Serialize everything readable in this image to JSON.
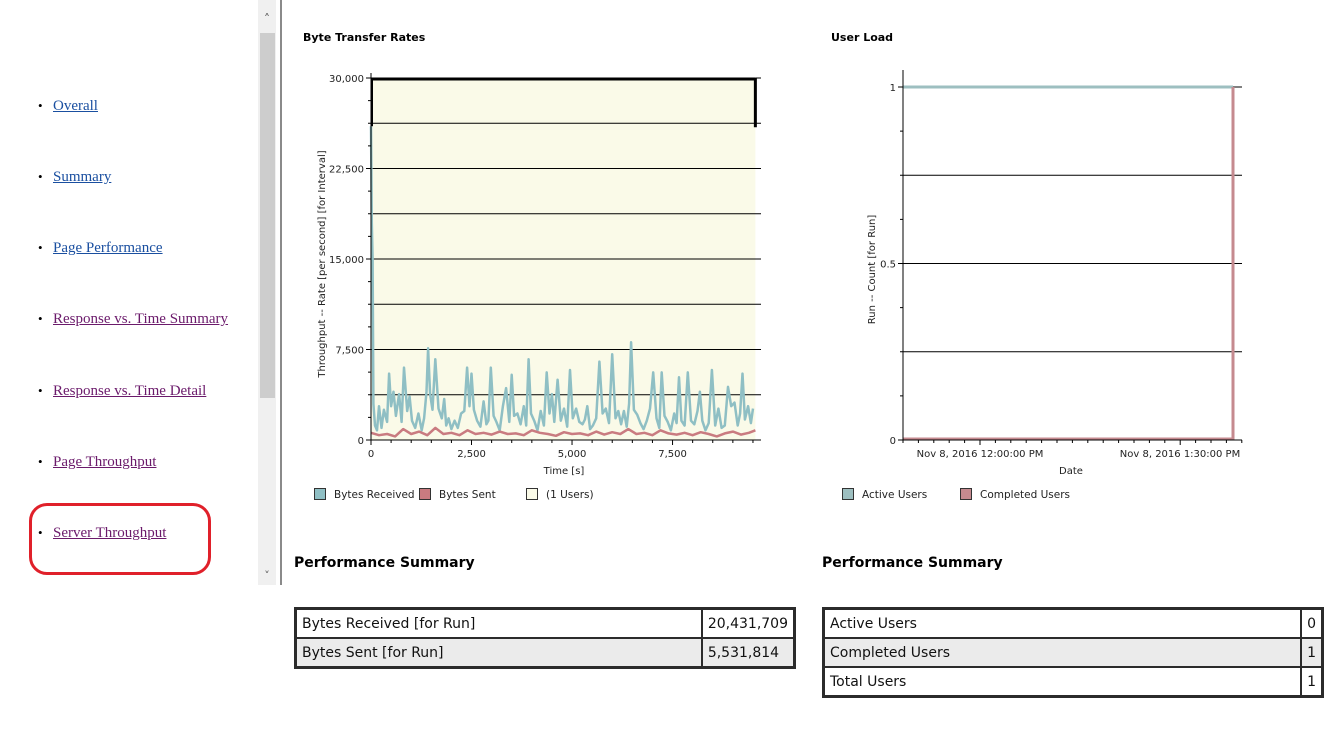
{
  "nav": {
    "items": [
      {
        "label": "Overall",
        "state": "link"
      },
      {
        "label": "Summary",
        "state": "link"
      },
      {
        "label": "Page Performance",
        "state": "link"
      },
      {
        "label": "Response vs. Time Summary",
        "state": "visited"
      },
      {
        "label": "Response vs. Time Detail",
        "state": "visited"
      },
      {
        "label": "Page Throughput",
        "state": "visited"
      },
      {
        "label": "Server Throughput",
        "state": "visited",
        "highlighted": true
      }
    ],
    "bullet": "•",
    "scroll_up_icon": "˄",
    "scroll_down_icon": "˅"
  },
  "colors": {
    "link": "#1a4fa0",
    "visited": "#6b1a6b",
    "highlight": "#e0202a",
    "bytes_received": "#8fbfc4",
    "bytes_sent": "#c97b80",
    "plot_bg": "#fafae8",
    "active_users": "#9dbfc0",
    "completed_users": "#c58a8f"
  },
  "chart_data": [
    {
      "type": "line",
      "title": "Byte Transfer Rates",
      "xlabel": "Time [s]",
      "ylabel": "Throughput -- Rate [per second] [for Interval]",
      "xlim": [
        0,
        9700
      ],
      "ylim": [
        0,
        30000
      ],
      "xticks": [
        0,
        2500,
        5000,
        7500
      ],
      "xtick_labels": [
        "0",
        "2,500",
        "5,000",
        "7,500"
      ],
      "yticks": [
        0,
        7500,
        15000,
        22500,
        30000
      ],
      "ytick_labels": [
        "0",
        "7,500",
        "15,000",
        "22,500",
        "30,000"
      ],
      "gridlines": [
        3750,
        7500,
        11250,
        15000,
        18750,
        22500,
        26250
      ],
      "grid": true,
      "legend": "bottom",
      "series": [
        {
          "name": "Bytes Received",
          "x": [
            0,
            20,
            40,
            60,
            100,
            150,
            200,
            260,
            320,
            400,
            450,
            500,
            560,
            620,
            700,
            760,
            820,
            900,
            960,
            1020,
            1100,
            1180,
            1260,
            1320,
            1380,
            1420,
            1470,
            1530,
            1600,
            1680,
            1760,
            1820,
            1870,
            1930,
            2000,
            2080,
            2160,
            2240,
            2320,
            2390,
            2450,
            2500,
            2560,
            2640,
            2720,
            2800,
            2870,
            2920,
            2980,
            3050,
            3120,
            3200,
            3280,
            3360,
            3440,
            3500,
            3560,
            3640,
            3720,
            3800,
            3860,
            3920,
            3980,
            4060,
            4140,
            4220,
            4300,
            4370,
            4440,
            4500,
            4560,
            4640,
            4720,
            4800,
            4880,
            4950,
            5020,
            5100,
            5180,
            5260,
            5320,
            5380,
            5450,
            5520,
            5600,
            5680,
            5760,
            5840,
            5920,
            6000,
            6080,
            6150,
            6220,
            6290,
            6360,
            6420,
            6470,
            6540,
            6620,
            6700,
            6780,
            6860,
            6940,
            7020,
            7100,
            7170,
            7230,
            7300,
            7380,
            7460,
            7540,
            7600,
            7660,
            7720,
            7800,
            7880,
            7960,
            8040,
            8120,
            8180,
            8240,
            8320,
            8400,
            8480,
            8560,
            8640,
            8720,
            8800,
            8880,
            8960,
            9040,
            9120,
            9180,
            9240,
            9300,
            9380,
            9450,
            9500,
            9560
          ],
          "values": [
            26000,
            18000,
            15000,
            3000,
            1200,
            800,
            2800,
            1000,
            2500,
            1500,
            5500,
            2800,
            4000,
            2000,
            3800,
            1500,
            6000,
            2400,
            3600,
            1600,
            1000,
            2200,
            800,
            1800,
            4000,
            7600,
            3800,
            2500,
            6700,
            2600,
            1800,
            3400,
            1200,
            1800,
            900,
            1600,
            1000,
            2200,
            2400,
            6000,
            2800,
            5500,
            2500,
            1600,
            1100,
            3200,
            1300,
            1600,
            6000,
            2000,
            1500,
            800,
            2800,
            4300,
            1500,
            5400,
            2000,
            2200,
            1300,
            2800,
            1200,
            6700,
            2200,
            1600,
            800,
            2400,
            1200,
            5600,
            2200,
            3800,
            1500,
            5000,
            1600,
            2600,
            1100,
            5800,
            1800,
            2600,
            1500,
            1300,
            1700,
            2800,
            900,
            1200,
            1800,
            6500,
            2200,
            2600,
            1400,
            7100,
            1800,
            2400,
            1300,
            2400,
            1100,
            3000,
            8100,
            2500,
            2100,
            1400,
            900,
            1600,
            2600,
            5600,
            1800,
            1000,
            5600,
            2000,
            1500,
            800,
            2200,
            1400,
            5200,
            1600,
            1200,
            5600,
            1600,
            1300,
            2400,
            4000,
            1600,
            800,
            1400,
            5800,
            1200,
            2600,
            1000,
            1200,
            4400,
            2800,
            3100,
            1200,
            2200,
            5500,
            1700,
            2800,
            1400,
            2600
          ]
        },
        {
          "name": "Bytes Sent",
          "x": [
            0,
            200,
            400,
            600,
            800,
            1000,
            1200,
            1400,
            1600,
            1800,
            2000,
            2200,
            2400,
            2600,
            2800,
            3000,
            3200,
            3400,
            3600,
            3800,
            4000,
            4200,
            4400,
            4600,
            4800,
            5000,
            5200,
            5400,
            5600,
            5800,
            6000,
            6200,
            6400,
            6600,
            6800,
            7000,
            7200,
            7400,
            7600,
            7800,
            8000,
            8200,
            8400,
            8600,
            8800,
            9000,
            9200,
            9400,
            9560
          ],
          "values": [
            600,
            400,
            500,
            300,
            900,
            500,
            700,
            400,
            1000,
            500,
            600,
            400,
            800,
            500,
            600,
            450,
            700,
            500,
            550,
            400,
            800,
            600,
            500,
            350,
            650,
            500,
            550,
            400,
            700,
            450,
            650,
            500,
            900,
            500,
            600,
            400,
            800,
            550,
            450,
            600,
            400,
            650,
            500,
            300,
            550,
            700,
            450,
            600,
            800
          ]
        },
        {
          "name": "(1 Users)",
          "kind": "band",
          "x_range": [
            0,
            9560
          ],
          "value": 30000
        }
      ]
    },
    {
      "type": "line",
      "title": "User Load",
      "xlabel": "Date",
      "ylabel": "Run -- Count [for Run]",
      "ylim": [
        0,
        1.05
      ],
      "yticks": [
        0,
        0.5,
        1
      ],
      "ytick_labels": [
        "0",
        "0.5",
        "1"
      ],
      "gridlines": [
        0.25,
        0.5,
        0.75
      ],
      "xtick_labels": [
        "Nov 8, 2016 12:00:00 PM",
        "Nov 8, 2016 1:30:00 PM"
      ],
      "grid": true,
      "legend": "bottom",
      "series": [
        {
          "name": "Active Users",
          "x": [
            "start",
            "end"
          ],
          "values": [
            1,
            1
          ]
        },
        {
          "name": "Completed Users",
          "x": [
            "start",
            "end",
            "end"
          ],
          "values": [
            0,
            0,
            1
          ]
        }
      ]
    }
  ],
  "charts": {
    "bytes": {
      "title": "Byte Transfer Rates",
      "ylabel": "Throughput -- Rate [per second] [for Interval]",
      "xlabel": "Time [s]",
      "legend": [
        "Bytes Received",
        "Bytes Sent",
        "(1 Users)"
      ]
    },
    "users": {
      "title": "User Load",
      "ylabel": "Run -- Count [for Run]",
      "xlabel": "Date",
      "legend": [
        "Active Users",
        "Completed Users"
      ]
    }
  },
  "summary_left": {
    "title": "Performance Summary",
    "rows": [
      {
        "label": "Bytes Received [for Run]",
        "value": "20,431,709"
      },
      {
        "label": "Bytes Sent [for Run]",
        "value": "5,531,814"
      }
    ]
  },
  "summary_right": {
    "title": "Performance Summary",
    "rows": [
      {
        "label": "Active Users",
        "value": "0"
      },
      {
        "label": "Completed Users",
        "value": "1"
      },
      {
        "label": "Total Users",
        "value": "1"
      }
    ]
  }
}
